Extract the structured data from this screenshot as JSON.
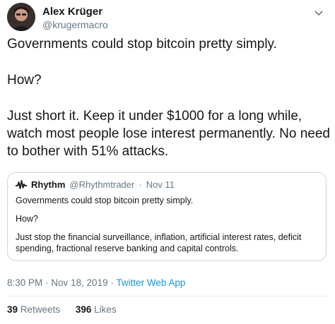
{
  "tweet": {
    "author": {
      "name": "Alex Krüger",
      "handle": "@krugermacro"
    },
    "text": {
      "p1": "Governments could stop bitcoin pretty simply.",
      "p2": "How?",
      "p3": "Just short it. Keep it under $1000 for a long while, watch most people lose interest permanently. No need to bother with 51% attacks."
    },
    "quoted": {
      "name": "Rhythm",
      "handle": "@Rhythmtrader",
      "separator": "·",
      "date": "Nov 11",
      "p1": "Governments could stop bitcoin pretty simply.",
      "p2": "How?",
      "p3": "Just stop the financial surveillance, inflation, artificial interest rates, deficit spending, fractional reserve banking and capital controls."
    },
    "timestamp": "8:30 PM · Nov 18, 2019 ·",
    "source": "Twitter Web App",
    "stats": {
      "retweets_count": "39",
      "retweets_label": "Retweets",
      "likes_count": "396",
      "likes_label": "Likes"
    }
  },
  "icons": {
    "more": "chevron-down-icon",
    "quoted_avatar": "waveform-icon"
  },
  "colors": {
    "text": "#14171a",
    "secondary": "#657786",
    "link": "#1b95e0",
    "border": "#ccd6dd"
  }
}
